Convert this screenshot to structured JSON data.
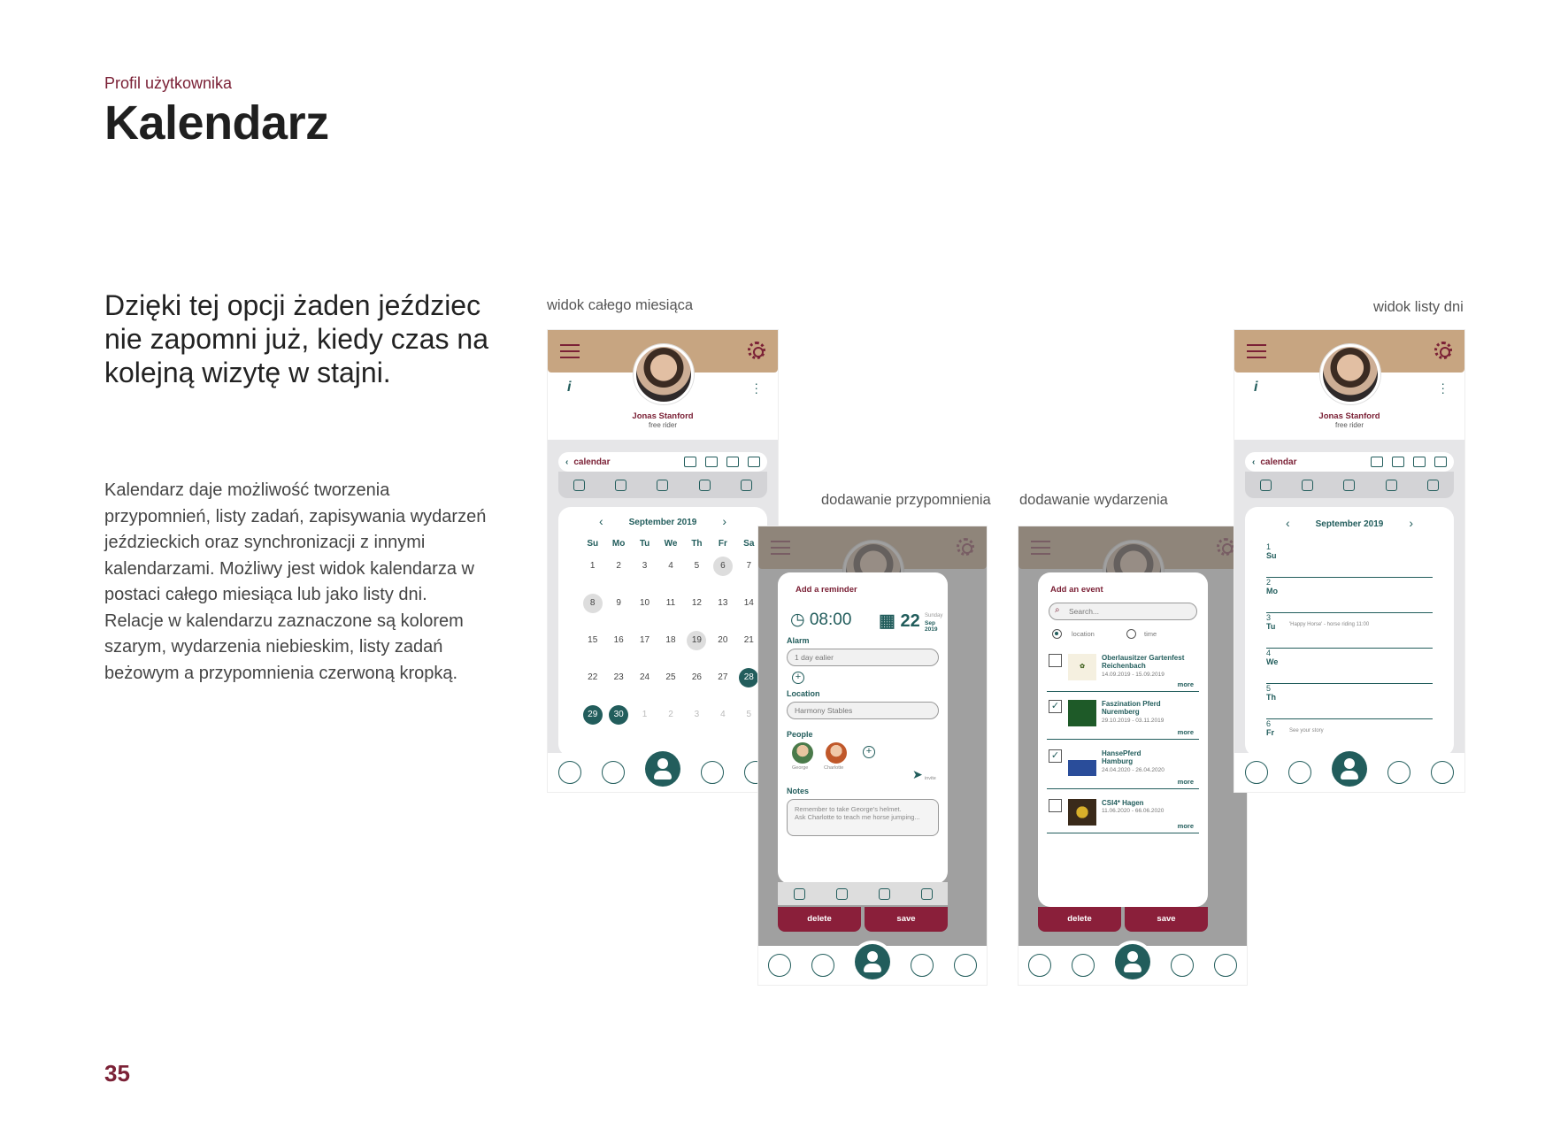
{
  "page": {
    "kicker": "Profil użytkownika",
    "title": "Kalendarz",
    "lead": "Dzięki tej opcji żaden jeździec nie zapomni już, kiedy czas na kolejną wizytę w stajni.",
    "body": "Kalendarz daje możliwość tworzenia przypomnień, listy zadań, zapisywania wydarzeń jeździeckich oraz synchronizacji z innymi kalendarzami. Możliwy jest widok kalendarza w postaci całego miesiąca lub jako listy dni. Relacje w kalendarzu zaznaczone są kolorem szarym, wydarzenia niebieskim, listy zadań beżowym a przypomnienia czerwoną kropką.",
    "page_number": "35"
  },
  "captions": {
    "month": "widok całego miesiąca",
    "reminder": "dodawanie przypomnienia",
    "event": "dodawanie wydarzenia",
    "daylist": "widok listy dni"
  },
  "profile": {
    "name": "Jonas Stanford",
    "role": "free rider",
    "info_icon": "i"
  },
  "calendar": {
    "toolbar_label": "calendar",
    "month": "September 2019",
    "day_headers": [
      "Su",
      "Mo",
      "Tu",
      "We",
      "Th",
      "Fr",
      "Sa"
    ],
    "weeks": [
      [
        "1",
        "2",
        "3",
        "4",
        "5",
        "6",
        "7"
      ],
      [
        "8",
        "9",
        "10",
        "11",
        "12",
        "13",
        "14"
      ],
      [
        "15",
        "16",
        "17",
        "18",
        "19",
        "20",
        "21"
      ],
      [
        "22",
        "23",
        "24",
        "25",
        "26",
        "27",
        "28"
      ],
      [
        "29",
        "30",
        "1",
        "2",
        "3",
        "4",
        "5"
      ]
    ]
  },
  "reminder": {
    "title": "Add a reminder",
    "time": "08:00",
    "date_day": "22",
    "date_weekday": "Sunday",
    "date_month": "Sep 2019",
    "alarm_label": "Alarm",
    "alarm_value": "1 day ealier",
    "location_label": "Location",
    "location_value": "Harmony Stables",
    "people_label": "People",
    "people": [
      "George",
      "Charlotte"
    ],
    "invite": "invite",
    "notes_label": "Notes",
    "notes_line1": "Remember to take George's helmet.",
    "notes_line2": "Ask Charlotte to teach me horse jumping...",
    "delete": "delete",
    "save": "save"
  },
  "event": {
    "title": "Add an event",
    "search_placeholder": "Search...",
    "opt_location": "location",
    "opt_time": "time",
    "more": "more",
    "items": [
      {
        "name1": "Oberlausitzer Gartenfest",
        "name2": "Reichenbach",
        "dates": "14.09.2019 - 15.09.2019",
        "checked": ""
      },
      {
        "name1": "Faszination Pferd",
        "name2": "Nuremberg",
        "dates": "29.10.2019 - 03.11.2019",
        "checked": "✓"
      },
      {
        "name1": "HansePferd",
        "name2": "Hamburg",
        "dates": "24.04.2020 - 26.04.2020",
        "checked": "✓"
      },
      {
        "name1": "CSI4* Hagen",
        "name2": "",
        "dates": "11.06.2020 - 66.06.2020",
        "checked": ""
      }
    ],
    "delete": "delete",
    "save": "save"
  },
  "daylist": {
    "month": "September 2019",
    "days": [
      {
        "num": "1",
        "name": "Su",
        "note": ""
      },
      {
        "num": "2",
        "name": "Mo",
        "note": ""
      },
      {
        "num": "3",
        "name": "Tu",
        "note": "'Happy Horse' - horse riding 11:00"
      },
      {
        "num": "4",
        "name": "We",
        "note": ""
      },
      {
        "num": "5",
        "name": "Th",
        "note": ""
      },
      {
        "num": "6",
        "name": "Fr",
        "note": "See your story"
      }
    ]
  },
  "colors": {
    "accent": "#7b2136",
    "teal": "#225d5c",
    "header": "#c7a581"
  }
}
